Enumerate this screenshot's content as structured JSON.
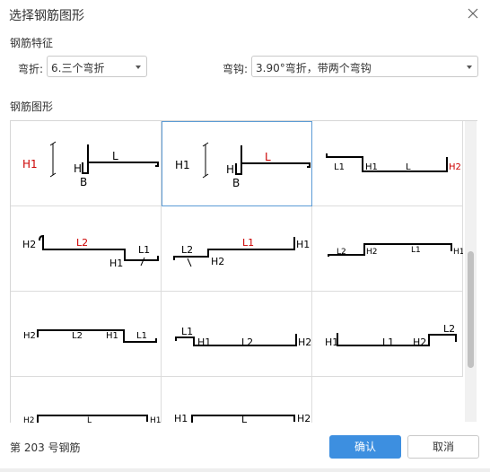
{
  "dialog": {
    "title": "选择钢筋图形",
    "close_icon": "close-icon"
  },
  "features": {
    "section_label": "钢筋特征",
    "bend_label": "弯折:",
    "bend_value": "6.三个弯折",
    "hook_label": "弯钩:",
    "hook_value": "3.90°弯折，带两个弯钩"
  },
  "shapes": {
    "section_label": "钢筋图形",
    "cells": [
      {
        "labels": [
          "H1",
          "H",
          "L",
          "B"
        ]
      },
      {
        "labels": [
          "H1",
          "H",
          "L",
          "B"
        ]
      },
      {
        "labels": [
          "L1",
          "H1",
          "L",
          "H2"
        ]
      },
      {
        "labels": [
          "H2",
          "L2",
          "L1",
          "H1"
        ]
      },
      {
        "labels": [
          "L2",
          "L1",
          "H1",
          "H2"
        ]
      },
      {
        "labels": [
          "L2",
          "H2",
          "L1",
          "H1"
        ]
      },
      {
        "labels": [
          "H2",
          "L2",
          "H1",
          "L1"
        ]
      },
      {
        "labels": [
          "L1",
          "H1",
          "L2",
          "H2"
        ]
      },
      {
        "labels": [
          "H1",
          "L1",
          "H2",
          "L2"
        ]
      },
      {
        "labels": [
          "H2",
          "L",
          "H1"
        ]
      },
      {
        "labels": [
          "H1",
          "L",
          "H2"
        ]
      }
    ]
  },
  "footer": {
    "status": "第 203 号钢筋",
    "ok_label": "确认",
    "cancel_label": "取消"
  },
  "colors": {
    "accent": "#3d8fe0",
    "selected_border": "#5b9bd5",
    "dimension_red": "#cc0000"
  }
}
